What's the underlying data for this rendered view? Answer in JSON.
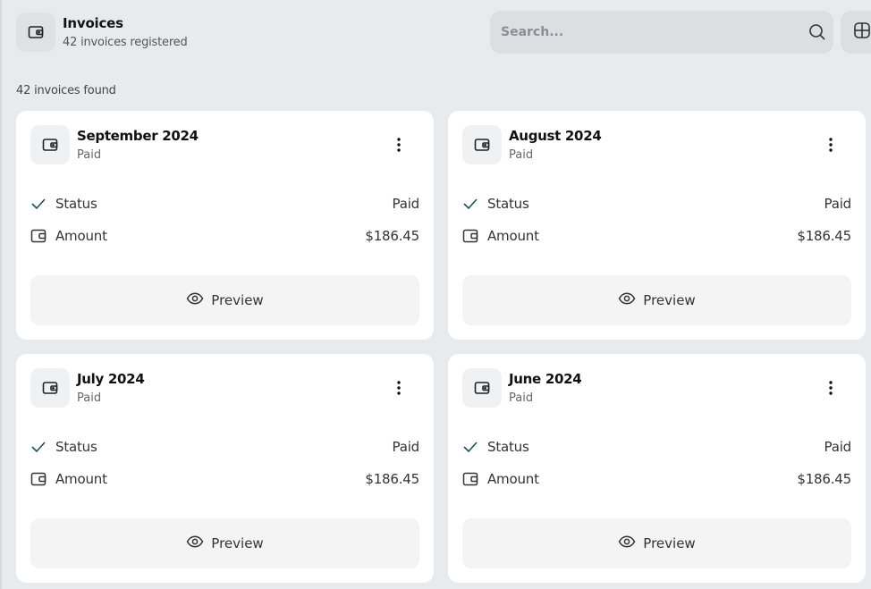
{
  "header": {
    "title": "Invoices",
    "subtitle": "42 invoices registered",
    "icon": "wallet-icon"
  },
  "search": {
    "placeholder": "Search...",
    "value": ""
  },
  "results_count": "42 invoices found",
  "cards": [
    {
      "title": "September 2024",
      "subtitle": "Paid",
      "status_label": "Status",
      "status_value": "Paid",
      "amount_label": "Amount",
      "amount_value": "$186.45",
      "action_label": "Preview"
    },
    {
      "title": "August 2024",
      "subtitle": "Paid",
      "status_label": "Status",
      "status_value": "Paid",
      "amount_label": "Amount",
      "amount_value": "$186.45",
      "action_label": "Preview"
    },
    {
      "title": "July 2024",
      "subtitle": "Paid",
      "status_label": "Status",
      "status_value": "Paid",
      "amount_label": "Amount",
      "amount_value": "$186.45",
      "action_label": "Preview"
    },
    {
      "title": "June 2024",
      "subtitle": "Paid",
      "status_label": "Status",
      "status_value": "Paid",
      "amount_label": "Amount",
      "amount_value": "$186.45",
      "action_label": "Preview"
    }
  ],
  "colors": {
    "background": "#e8ebed",
    "card": "#ffffff",
    "check": "#1f4e5a"
  }
}
